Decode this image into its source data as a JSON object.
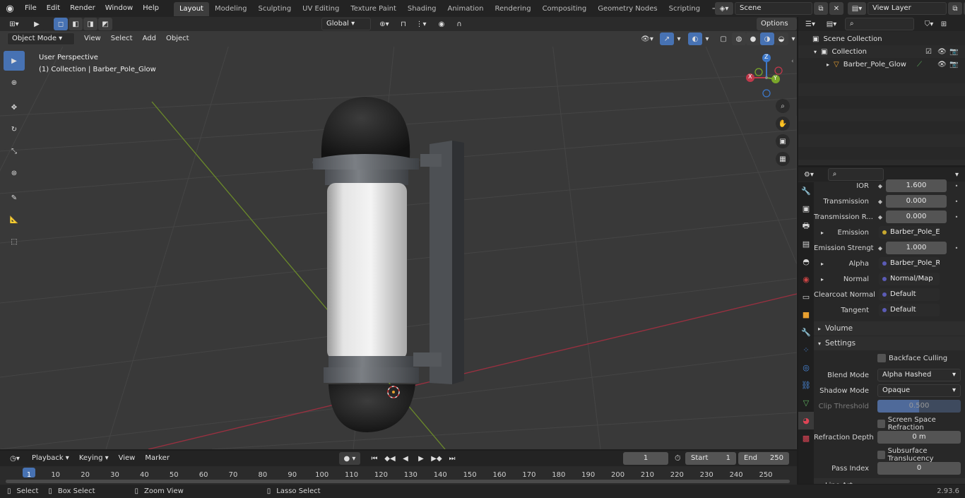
{
  "topbar": {
    "menus": [
      "File",
      "Edit",
      "Render",
      "Window",
      "Help"
    ],
    "workspaces": [
      "Layout",
      "Modeling",
      "Sculpting",
      "UV Editing",
      "Texture Paint",
      "Shading",
      "Animation",
      "Rendering",
      "Compositing",
      "Geometry Nodes",
      "Scripting"
    ],
    "active_workspace": "Layout",
    "add_tab": "+",
    "scene": "Scene",
    "view_layer": "View Layer"
  },
  "viewport_header": {
    "mode": "Object Mode",
    "menus": [
      "View",
      "Select",
      "Add",
      "Object"
    ],
    "transform_orientation": "Global",
    "options": "Options"
  },
  "viewport": {
    "perspective": "User Perspective",
    "collection_info": "(1) Collection | Barber_Pole_Glow",
    "gizmo": {
      "x": "X",
      "y": "Y",
      "z": "Z"
    }
  },
  "outliner": {
    "root": "Scene Collection",
    "collection": "Collection",
    "object": "Barber_Pole_Glow"
  },
  "properties": {
    "rows": [
      {
        "label": "IOR",
        "value": "1.600",
        "type": "value"
      },
      {
        "label": "Transmission",
        "value": "0.000",
        "type": "value"
      },
      {
        "label": "Transmission R...",
        "value": "0.000",
        "type": "value"
      },
      {
        "label": "Emission",
        "value": "Barber_Pole_Emissi...",
        "type": "link",
        "dot": "#c7a82f",
        "expand": true
      },
      {
        "label": "Emission Strengt",
        "value": "1.000",
        "type": "value"
      },
      {
        "label": "Alpha",
        "value": "Barber_Pole_Refract...",
        "type": "link",
        "dot": "#5b5bb5",
        "expand": true
      },
      {
        "label": "Normal",
        "value": "Normal/Map",
        "type": "link",
        "dot": "#5b5bb5",
        "expand": true
      },
      {
        "label": "Clearcoat Normal",
        "value": "Default",
        "type": "link",
        "dot": "#5b5bb5"
      },
      {
        "label": "Tangent",
        "value": "Default",
        "type": "link",
        "dot": "#5b5bb5"
      }
    ],
    "panel_volume": "Volume",
    "panel_settings": "Settings",
    "backface_culling": "Backface Culling",
    "blend_mode_label": "Blend Mode",
    "blend_mode": "Alpha Hashed",
    "shadow_mode_label": "Shadow Mode",
    "shadow_mode": "Opaque",
    "clip_threshold_label": "Clip Threshold",
    "clip_threshold": "0.500",
    "screen_space_refraction": "Screen Space Refraction",
    "refraction_depth_label": "Refraction Depth",
    "refraction_depth": "0 m",
    "subsurface_translucency": "Subsurface Translucency",
    "pass_index_label": "Pass Index",
    "pass_index": "0",
    "next_panel": "Line Art"
  },
  "timeline": {
    "menus": [
      "Playback",
      "Keying",
      "View",
      "Marker"
    ],
    "current_frame": "1",
    "start_label": "Start",
    "start": "1",
    "end_label": "End",
    "end": "250",
    "ticks": [
      "1",
      "10",
      "20",
      "30",
      "40",
      "50",
      "60",
      "70",
      "80",
      "90",
      "100",
      "110",
      "120",
      "130",
      "140",
      "150",
      "160",
      "170",
      "180",
      "190",
      "200",
      "210",
      "220",
      "230",
      "240",
      "250"
    ]
  },
  "statusbar": {
    "select": "Select",
    "box_select": "Box Select",
    "zoom_view": "Zoom View",
    "lasso_select": "Lasso Select",
    "version": "2.93.6"
  },
  "colors": {
    "accent": "#4772b3",
    "x_axis": "#c0394b",
    "y_axis": "#7aa62a",
    "z_axis": "#3d78c9"
  }
}
